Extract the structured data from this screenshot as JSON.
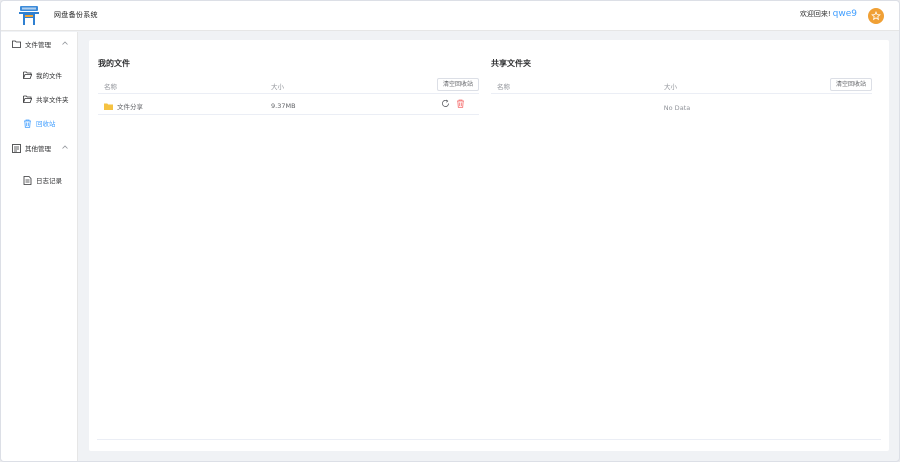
{
  "header": {
    "title": "网盘备份系统",
    "welcome_text": "欢迎回来!",
    "username": "qwe9"
  },
  "sidebar": {
    "groups": [
      {
        "label": "文件管理",
        "icon": "folder-icon",
        "items": [
          {
            "label": "我的文件",
            "icon": "folder-open-icon"
          },
          {
            "label": "共享文件夹",
            "icon": "folder-open-icon"
          },
          {
            "label": "回收站",
            "icon": "trash-icon",
            "active": true
          }
        ]
      },
      {
        "label": "其他管理",
        "icon": "document-icon",
        "items": [
          {
            "label": "日志记录",
            "icon": "log-icon"
          }
        ]
      }
    ]
  },
  "my_files": {
    "title": "我的文件",
    "columns": [
      "名称",
      "大小"
    ],
    "clear_button": "清空回收站",
    "rows": [
      {
        "name": "文件分享",
        "size": "9.37MB"
      }
    ]
  },
  "shared_folder": {
    "title": "共享文件夹",
    "columns": [
      "名称",
      "大小"
    ],
    "clear_button": "清空回收站",
    "empty_text": "No Data"
  },
  "colors": {
    "accent": "#409eff",
    "avatar": "#f0a035",
    "folder": "#f5c242",
    "delete": "#f56c6c"
  }
}
